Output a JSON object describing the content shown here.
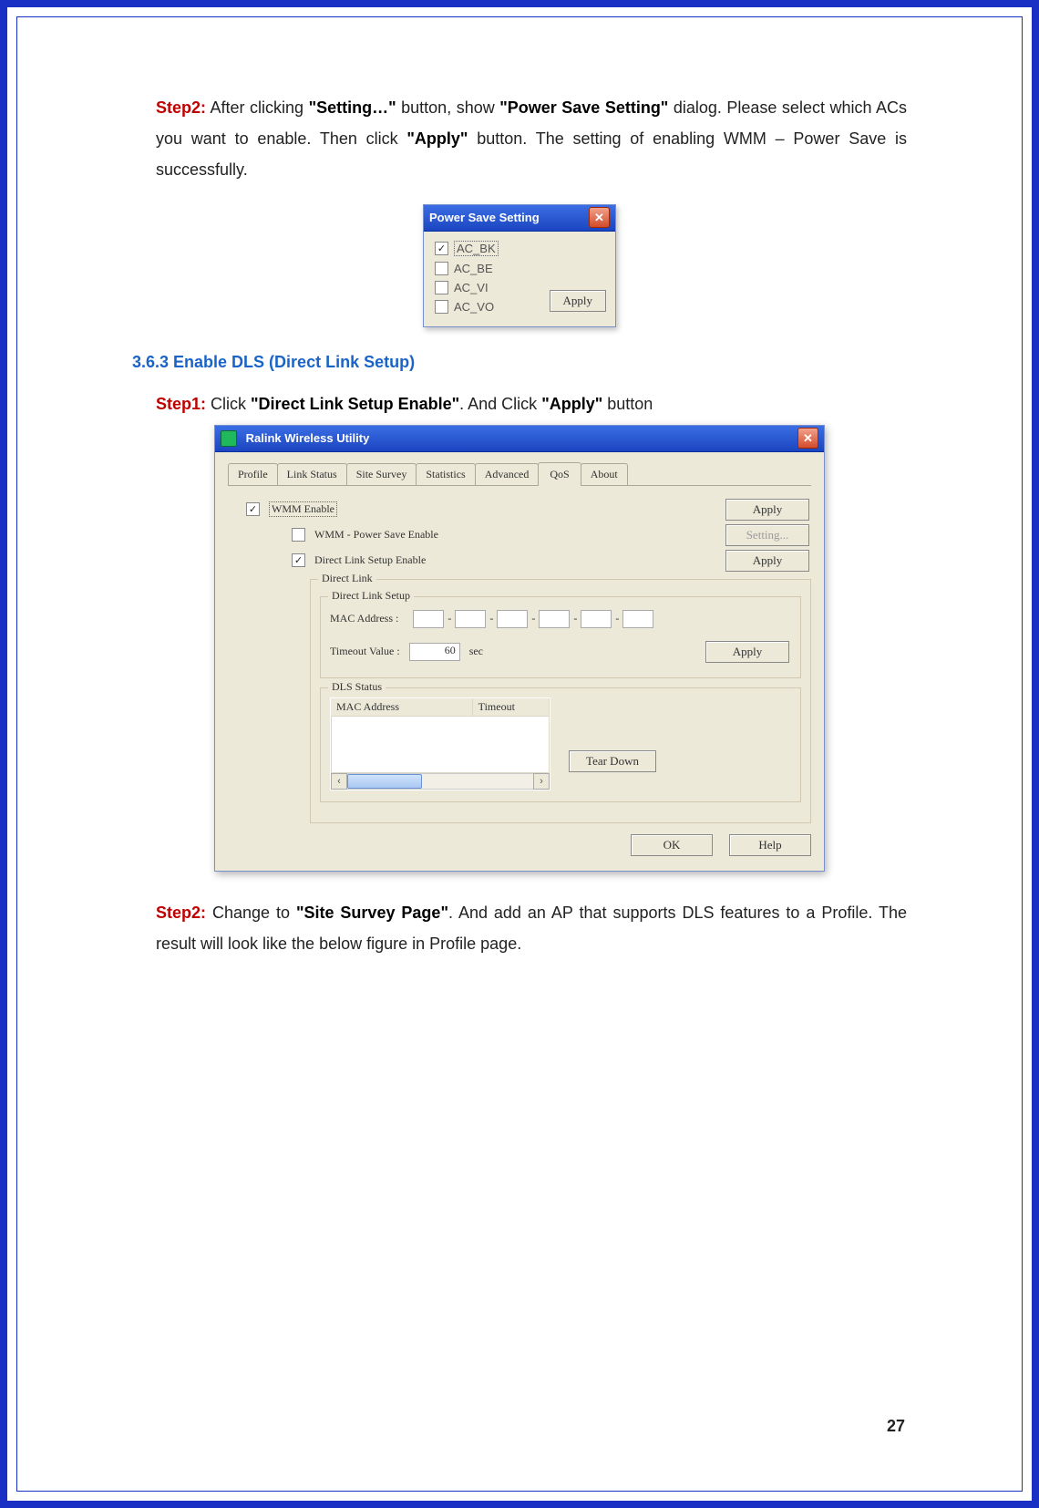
{
  "text": {
    "step2a_label": "Step2:",
    "step2a_rest": " After clicking ",
    "step2a_b1": "\"Setting…\"",
    "step2a_mid1": " button, show ",
    "step2a_b2": "\"Power Save Setting\"",
    "step2a_mid2": " dialog. Please select which ACs you want to enable. Then click ",
    "step2a_b3": "\"Apply\"",
    "step2a_tail": " button. The setting of enabling WMM – Power Save is successfully.",
    "section_363": "3.6.3 Enable DLS (Direct Link Setup)",
    "step1_label": "Step1:",
    "step1_mid1": " Click ",
    "step1_b1": "\"Direct Link Setup Enable\"",
    "step1_mid2": ". And Click ",
    "step1_b2": "\"Apply\"",
    "step1_tail": " button",
    "step2b_label": "Step2:",
    "step2b_mid1": " Change to ",
    "step2b_b1": "\"Site Survey Page\"",
    "step2b_tail": ". And add an AP that supports DLS features to a Profile. The result will look like the below figure in Profile page.",
    "page_number": "27"
  },
  "power_save_dialog": {
    "title": "Power Save Setting",
    "options": [
      "AC_BK",
      "AC_BE",
      "AC_VI",
      "AC_VO"
    ],
    "checked": [
      true,
      false,
      false,
      false
    ],
    "apply": "Apply"
  },
  "util": {
    "title": "Ralink Wireless Utility",
    "tabs": [
      "Profile",
      "Link Status",
      "Site Survey",
      "Statistics",
      "Advanced",
      "QoS",
      "About"
    ],
    "active_tab": "QoS",
    "wmm_enable": "WMM Enable",
    "wmm_ps": "WMM - Power Save Enable",
    "dls_enable": "Direct Link Setup Enable",
    "apply": "Apply",
    "setting": "Setting...",
    "direct_link_legend": "Direct Link",
    "dls_setup_legend": "Direct Link Setup",
    "mac_label": "MAC Address :",
    "timeout_label": "Timeout Value :",
    "timeout_value": "60",
    "timeout_unit": "sec",
    "dls_status_legend": "DLS Status",
    "col_mac": "MAC Address",
    "col_timeout": "Timeout",
    "tear_down": "Tear Down",
    "ok": "OK",
    "help": "Help"
  }
}
